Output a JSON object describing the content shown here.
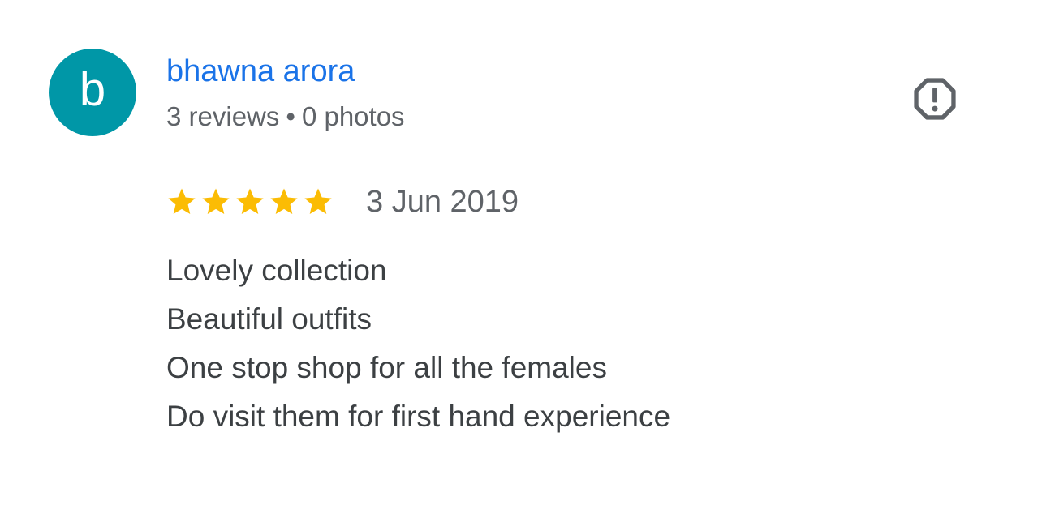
{
  "review": {
    "author": {
      "initial": "b",
      "name": "bhawna arora",
      "reviews_count": "3 reviews",
      "separator": "•",
      "photos_count": "0 photos",
      "avatar_color": "#0097a7"
    },
    "report_icon": "report-octagon-icon",
    "rating": {
      "stars": 5,
      "max_stars": 5,
      "star_color": "#fbbc04"
    },
    "date": "3 Jun 2019",
    "text_lines": [
      "Lovely collection",
      "Beautiful outfits",
      "One stop shop for all the females",
      "Do visit them for first hand experience"
    ],
    "colors": {
      "name": "#1a73e8",
      "meta": "#5f6368",
      "body": "#3c4043"
    }
  }
}
